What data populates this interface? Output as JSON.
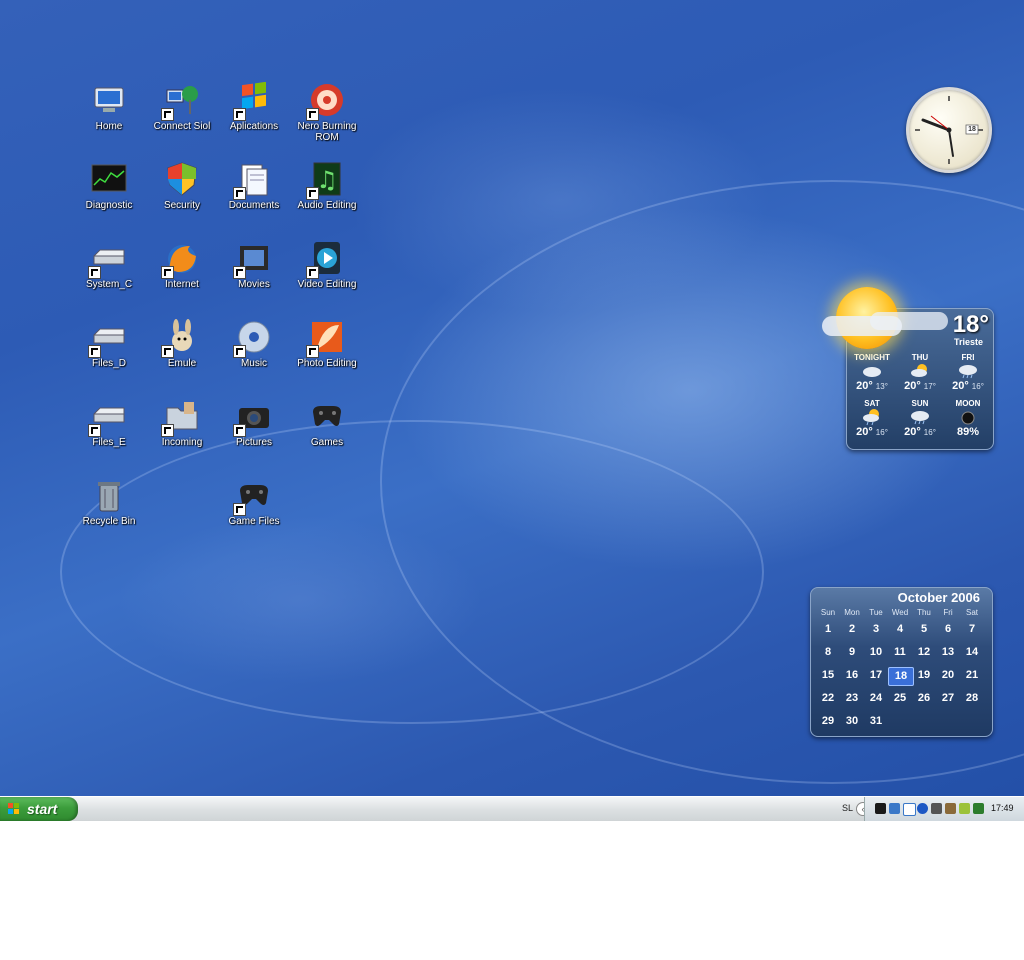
{
  "desktop": {
    "icons": [
      {
        "label": "Home",
        "kind": "computer-icon",
        "shortcut": false
      },
      {
        "label": "Connect Siol",
        "kind": "network-icon",
        "shortcut": true
      },
      {
        "label": "Aplications",
        "kind": "windows-flag-icon",
        "shortcut": true
      },
      {
        "label": "Nero Burning ROM",
        "kind": "nero-icon",
        "shortcut": true
      },
      {
        "label": "Diagnostic",
        "kind": "monitor-chart-icon",
        "shortcut": false
      },
      {
        "label": "Security",
        "kind": "shield-icon",
        "shortcut": false
      },
      {
        "label": "Documents",
        "kind": "documents-icon",
        "shortcut": true
      },
      {
        "label": "Audio Editing",
        "kind": "music-note-icon",
        "shortcut": true
      },
      {
        "label": "System_C",
        "kind": "drive-icon",
        "shortcut": true
      },
      {
        "label": "Internet",
        "kind": "firefox-icon",
        "shortcut": true
      },
      {
        "label": "Movies",
        "kind": "film-icon",
        "shortcut": true
      },
      {
        "label": "Video Editing",
        "kind": "play-icon",
        "shortcut": true
      },
      {
        "label": "Files_D",
        "kind": "drive-icon",
        "shortcut": true
      },
      {
        "label": "Emule",
        "kind": "mule-icon",
        "shortcut": true
      },
      {
        "label": "Music",
        "kind": "cd-icon",
        "shortcut": true
      },
      {
        "label": "Photo Editing",
        "kind": "feather-icon",
        "shortcut": true
      },
      {
        "label": "Files_E",
        "kind": "drive-icon",
        "shortcut": true
      },
      {
        "label": "Incoming",
        "kind": "folder-icon",
        "shortcut": true
      },
      {
        "label": "Pictures",
        "kind": "camera-icon",
        "shortcut": true
      },
      {
        "label": "Games",
        "kind": "gamepad-icon",
        "shortcut": false
      },
      {
        "label": "Recycle Bin",
        "kind": "trash-icon",
        "shortcut": false
      },
      {
        "label": "Game Files",
        "kind": "gamepad-icon",
        "shortcut": true
      }
    ]
  },
  "clock": {
    "date_badge": "18"
  },
  "weather": {
    "current_temp": "18°",
    "city": "Trieste",
    "forecast": [
      {
        "day": "TONIGHT",
        "high": "20°",
        "low": "13°",
        "icon": "cloud-icon"
      },
      {
        "day": "THU",
        "high": "20°",
        "low": "17°",
        "icon": "sun-cloud-icon"
      },
      {
        "day": "FRI",
        "high": "20°",
        "low": "16°",
        "icon": "rain-icon"
      },
      {
        "day": "SAT",
        "high": "20°",
        "low": "16°",
        "icon": "sun-rain-icon"
      },
      {
        "day": "SUN",
        "high": "20°",
        "low": "16°",
        "icon": "rain-icon"
      },
      {
        "day": "MOON",
        "high": "89%",
        "low": "",
        "icon": "moon-icon"
      }
    ]
  },
  "calendar": {
    "title": "October 2006",
    "weekdays": [
      "Sun",
      "Mon",
      "Tue",
      "Wed",
      "Thu",
      "Fri",
      "Sat"
    ],
    "days": [
      "1",
      "2",
      "3",
      "4",
      "5",
      "6",
      "7",
      "8",
      "9",
      "10",
      "11",
      "12",
      "13",
      "14",
      "15",
      "16",
      "17",
      "18",
      "19",
      "20",
      "21",
      "22",
      "23",
      "24",
      "25",
      "26",
      "27",
      "28",
      "29",
      "30",
      "31"
    ],
    "today": "18"
  },
  "taskbar": {
    "start_label": "start",
    "language": "SL",
    "time": "17:49"
  },
  "colors": {
    "desktop_blue": "#2d5bb5",
    "start_green": "#3c9d3c",
    "today_highlight": "#3a6fd8"
  }
}
